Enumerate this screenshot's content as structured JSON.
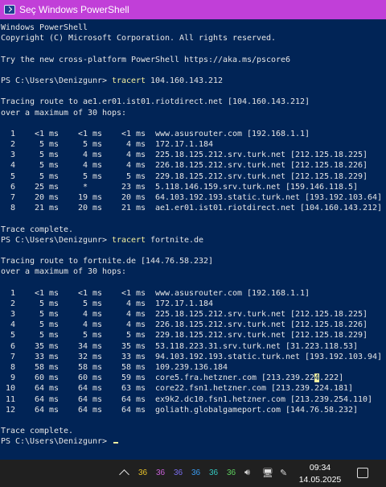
{
  "window": {
    "title": "Seç Windows PowerShell"
  },
  "console": {
    "header": [
      "Windows PowerShell",
      "Copyright (C) Microsoft Corporation. All rights reserved.",
      "",
      "Try the new cross-platform PowerShell https://aka.ms/pscore6",
      ""
    ],
    "prompt": "PS C:\\Users\\Denizgunr> ",
    "cmd1": {
      "command": "tracert",
      "arg": "104.160.143.212"
    },
    "trace1": [
      "",
      "Tracing route to ae1.er01.ist01.riotdirect.net [104.160.143.212]",
      "over a maximum of 30 hops:",
      "",
      "  1    <1 ms    <1 ms    <1 ms  www.asusrouter.com [192.168.1.1]",
      "  2     5 ms     5 ms     4 ms  172.17.1.184",
      "  3     5 ms     4 ms     4 ms  225.18.125.212.srv.turk.net [212.125.18.225]",
      "  4     5 ms     4 ms     4 ms  226.18.125.212.srv.turk.net [212.125.18.226]",
      "  5     5 ms     5 ms     5 ms  229.18.125.212.srv.turk.net [212.125.18.229]",
      "  6    25 ms     *       23 ms  5.118.146.159.srv.turk.net [159.146.118.5]",
      "  7    20 ms    19 ms    20 ms  64.103.192.193.static.turk.net [193.192.103.64]",
      "  8    21 ms    20 ms    21 ms  ae1.er01.ist01.riotdirect.net [104.160.143.212]",
      "",
      "Trace complete."
    ],
    "cmd2": {
      "command": "tracert",
      "arg": "fortnite.de"
    },
    "trace2": [
      "",
      "Tracing route to fortnite.de [144.76.58.232]",
      "over a maximum of 30 hops:",
      "",
      "  1    <1 ms    <1 ms    <1 ms  www.asusrouter.com [192.168.1.1]",
      "  2     5 ms     5 ms     4 ms  172.17.1.184",
      "  3     5 ms     4 ms     4 ms  225.18.125.212.srv.turk.net [212.125.18.225]",
      "  4     5 ms     4 ms     4 ms  226.18.125.212.srv.turk.net [212.125.18.226]",
      "  5     5 ms     5 ms     5 ms  229.18.125.212.srv.turk.net [212.125.18.229]",
      "  6    35 ms    34 ms    35 ms  53.118.223.31.srv.turk.net [31.223.118.53]",
      "  7    33 ms    32 ms    33 ms  94.103.192.193.static.turk.net [193.192.103.94]",
      "  8    58 ms    58 ms    58 ms  109.239.136.184"
    ],
    "hop9": {
      "before": "  9    60 ms    60 ms    59 ms  core5.fra.hetzner.com [213.239.22",
      "highlight": "4",
      "after": ".222]"
    },
    "trace2_rest": [
      " 10    64 ms    64 ms    63 ms  core22.fsn1.hetzner.com [213.239.224.181]",
      " 11    64 ms    64 ms    64 ms  ex9k2.dc10.fsn1.hetzner.com [213.239.254.110]",
      " 12    64 ms    64 ms    64 ms  goliath.globalgameport.com [144.76.58.232]",
      "",
      "Trace complete."
    ]
  },
  "taskbar": {
    "tray_numbers": [
      "36",
      "36",
      "36",
      "36",
      "36",
      "36"
    ],
    "tray_colors": [
      "#e8c229",
      "#c860d8",
      "#7a6ef0",
      "#3a9bf0",
      "#35c8c0",
      "#5fd35f"
    ],
    "time": "09:34",
    "date": "14.05.2025"
  }
}
